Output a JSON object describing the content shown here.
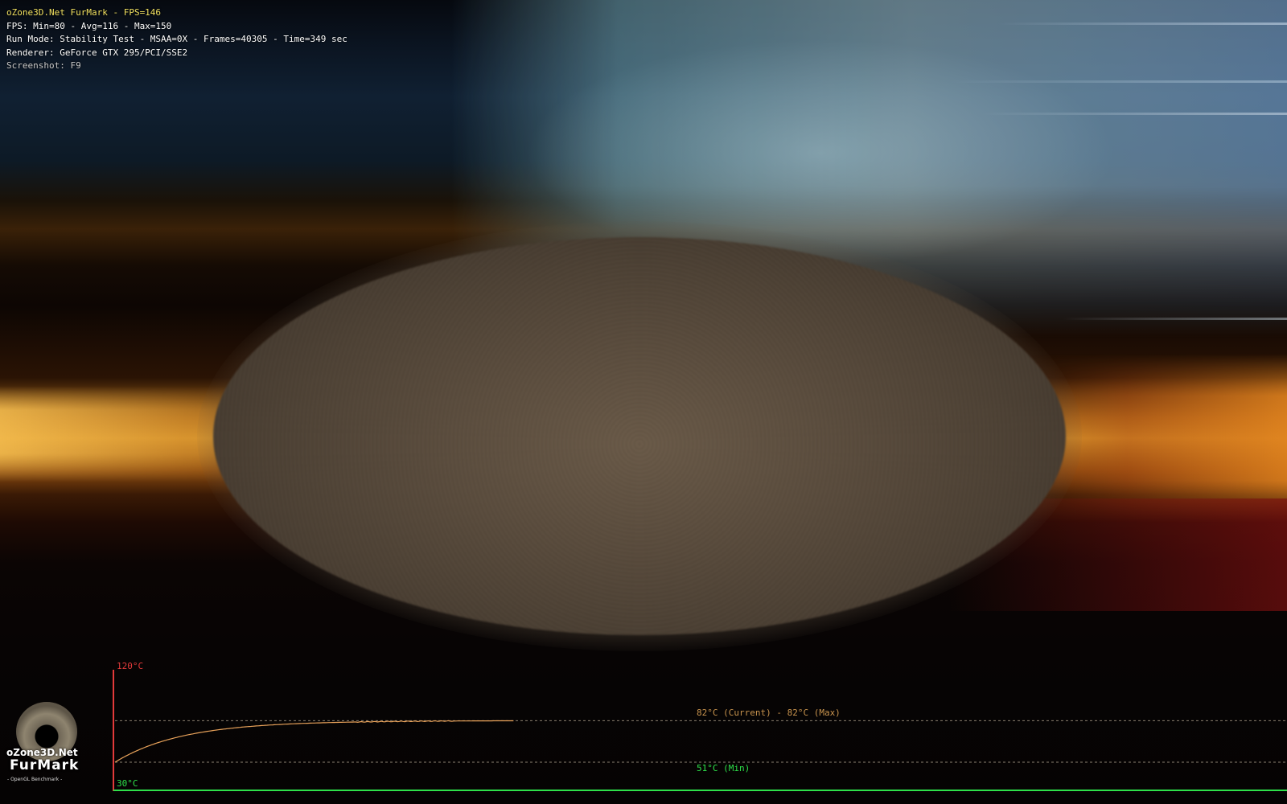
{
  "hud": {
    "title": "oZone3D.Net FurMark - FPS=146",
    "fps_stats": "FPS: Min=80 - Avg=116 - Max=150",
    "run_mode": "Run Mode: Stability Test - MSAA=0X - Frames=40305 - Time=349 sec",
    "renderer": "Renderer: GeForce GTX 295/PCI/SSE2",
    "screenshot_hint": "Screenshot: F9"
  },
  "temperature_graph": {
    "max_label": "120°C",
    "min_label": "30°C",
    "current_label": "82°C (Current) - 82°C (Max)",
    "observed_min_label": "51°C (Min)",
    "axis_max_c": 120,
    "axis_min_c": 30,
    "current_c": 82,
    "max_c": 82,
    "observed_min_c": 51,
    "axis_color": "#e23a3a",
    "baseline_color": "#2ee04a",
    "curve_color": "#e8a25a",
    "curve_end_fraction": 0.34
  },
  "logo": {
    "brand": "oZone3D.Net",
    "product": "FurMark",
    "tagline": "- OpenGL Benchmark -",
    "icon": "fur-donut-icon"
  }
}
